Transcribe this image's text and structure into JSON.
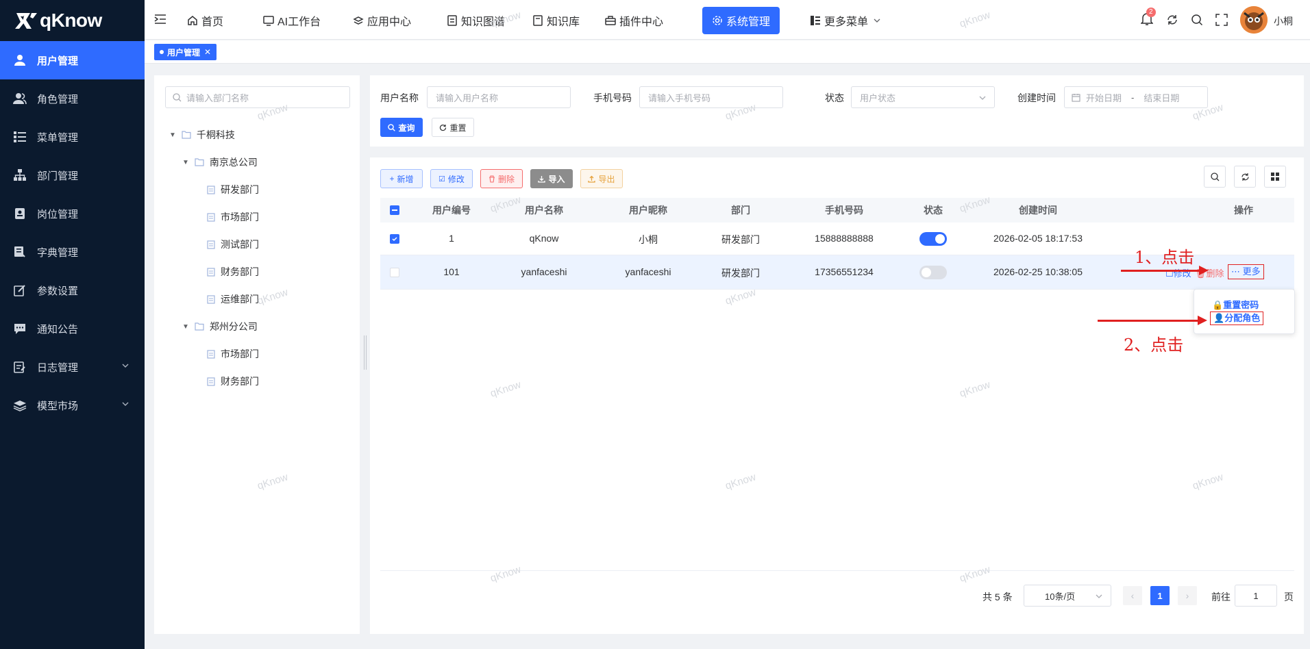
{
  "app": {
    "logo_text": "qKnow"
  },
  "sidebar": {
    "items": [
      {
        "label": "用户管理",
        "icon": "user-icon"
      },
      {
        "label": "角色管理",
        "icon": "users-icon"
      },
      {
        "label": "菜单管理",
        "icon": "list-icon"
      },
      {
        "label": "部门管理",
        "icon": "org-icon"
      },
      {
        "label": "岗位管理",
        "icon": "badge-icon"
      },
      {
        "label": "字典管理",
        "icon": "book-icon"
      },
      {
        "label": "参数设置",
        "icon": "edit-icon"
      },
      {
        "label": "通知公告",
        "icon": "message-icon"
      },
      {
        "label": "日志管理",
        "icon": "log-icon"
      },
      {
        "label": "模型市场",
        "icon": "layers-icon"
      }
    ]
  },
  "topnav": {
    "items": [
      "首页",
      "AI工作台",
      "应用中心",
      "知识图谱",
      "知识库",
      "插件中心",
      "系统管理",
      "更多菜单"
    ],
    "notif_count": "2",
    "username": "小桐"
  },
  "tabs": {
    "active": "用户管理"
  },
  "dept_tree": {
    "search_placeholder": "请输入部门名称",
    "root": "千桐科技",
    "nanjing": "南京总公司",
    "nanjing_children": [
      "研发部门",
      "市场部门",
      "测试部门",
      "财务部门",
      "运维部门"
    ],
    "zhengzhou": "郑州分公司",
    "zhengzhou_children": [
      "市场部门",
      "财务部门"
    ]
  },
  "search": {
    "username_label": "用户名称",
    "username_placeholder": "请输入用户名称",
    "phone_label": "手机号码",
    "phone_placeholder": "请输入手机号码",
    "status_label": "状态",
    "status_placeholder": "用户状态",
    "created_label": "创建时间",
    "start_placeholder": "开始日期",
    "range_sep": "-",
    "end_placeholder": "结束日期",
    "query_btn": "查询",
    "reset_btn": "重置"
  },
  "toolbar": {
    "add": "新增",
    "edit": "修改",
    "delete": "删除",
    "import": "导入",
    "export": "导出"
  },
  "table": {
    "columns": [
      "用户编号",
      "用户名称",
      "用户昵称",
      "部门",
      "手机号码",
      "状态",
      "创建时间",
      "操作"
    ],
    "rows": [
      {
        "id": "1",
        "username": "qKnow",
        "nickname": "小桐",
        "dept": "研发部门",
        "phone": "15888888888",
        "enabled": true,
        "created": "2026-02-05 18:17:53",
        "checked": true
      },
      {
        "id": "101",
        "username": "yanfaceshi",
        "nickname": "yanfaceshi",
        "dept": "研发部门",
        "phone": "17356551234",
        "enabled": false,
        "created": "2026-02-25 10:38:05",
        "checked": false,
        "actions": [
          "修改",
          "删除",
          "更多"
        ]
      }
    ]
  },
  "dropdown": {
    "items": [
      "重置密码",
      "分配角色"
    ]
  },
  "annotations": {
    "step1": "1、点击",
    "step2": "2、点击"
  },
  "pagination": {
    "total": "共 5 条",
    "page_size": "10条/页",
    "current": "1",
    "goto_label": "前往",
    "goto_value": "1",
    "page_suffix": "页"
  },
  "watermark": "qKnow",
  "colors": {
    "primary": "#2f6bff",
    "sidebar_bg": "#0b1a2e",
    "danger": "#f56c6c",
    "warning": "#e6a23c",
    "annotation": "#e02020"
  }
}
